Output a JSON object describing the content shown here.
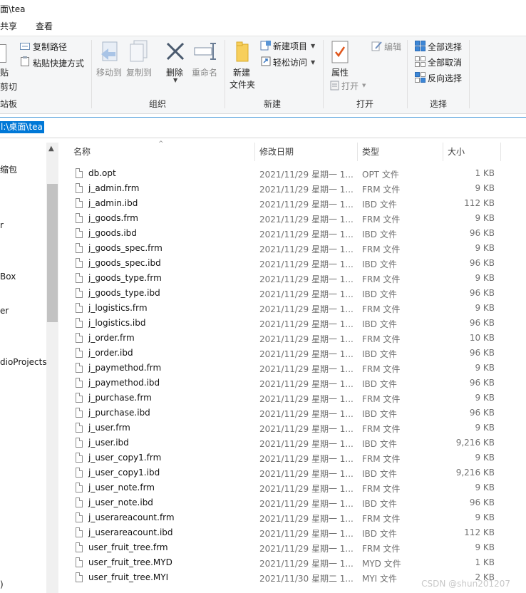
{
  "window": {
    "title": "面\\tea"
  },
  "menu": {
    "share": "共享",
    "view": "查看"
  },
  "ribbon": {
    "clipboard": {
      "paste_partial": "贴",
      "cut_partial": "剪切",
      "group_partial": "站板",
      "copy_path": "复制路径",
      "paste_shortcut": "粘贴快捷方式"
    },
    "organize": {
      "move_to": "移动到",
      "copy_to": "复制到",
      "delete": "删除",
      "rename": "重命名",
      "group": "组织"
    },
    "new": {
      "new_folder_line1": "新建",
      "new_folder_line2": "文件夹",
      "new_item": "新建项目",
      "easy_access": "轻松访问",
      "group": "新建"
    },
    "open": {
      "properties": "属性",
      "open": "打开",
      "edit": "编辑",
      "group": "打开"
    },
    "select": {
      "select_all": "全部选择",
      "select_none": "全部取消",
      "invert": "反向选择",
      "group": "选择"
    }
  },
  "address": {
    "path": "l:\\桌面\\tea"
  },
  "nav_pane": {
    "items": [
      "缩包",
      "r",
      "Box",
      "er",
      "dioProjects",
      ")"
    ]
  },
  "columns": {
    "name": "名称",
    "date": "修改日期",
    "type": "类型",
    "size": "大小"
  },
  "files": [
    {
      "name": "db.opt",
      "date": "2021/11/29 星期一 1...",
      "type": "OPT 文件",
      "size": "1 KB"
    },
    {
      "name": "j_admin.frm",
      "date": "2021/11/29 星期一 1...",
      "type": "FRM 文件",
      "size": "9 KB"
    },
    {
      "name": "j_admin.ibd",
      "date": "2021/11/29 星期一 1...",
      "type": "IBD 文件",
      "size": "112 KB"
    },
    {
      "name": "j_goods.frm",
      "date": "2021/11/29 星期一 1...",
      "type": "FRM 文件",
      "size": "9 KB"
    },
    {
      "name": "j_goods.ibd",
      "date": "2021/11/29 星期一 1...",
      "type": "IBD 文件",
      "size": "96 KB"
    },
    {
      "name": "j_goods_spec.frm",
      "date": "2021/11/29 星期一 1...",
      "type": "FRM 文件",
      "size": "9 KB"
    },
    {
      "name": "j_goods_spec.ibd",
      "date": "2021/11/29 星期一 1...",
      "type": "IBD 文件",
      "size": "96 KB"
    },
    {
      "name": "j_goods_type.frm",
      "date": "2021/11/29 星期一 1...",
      "type": "FRM 文件",
      "size": "9 KB"
    },
    {
      "name": "j_goods_type.ibd",
      "date": "2021/11/29 星期一 1...",
      "type": "IBD 文件",
      "size": "96 KB"
    },
    {
      "name": "j_logistics.frm",
      "date": "2021/11/29 星期一 1...",
      "type": "FRM 文件",
      "size": "9 KB"
    },
    {
      "name": "j_logistics.ibd",
      "date": "2021/11/29 星期一 1...",
      "type": "IBD 文件",
      "size": "96 KB"
    },
    {
      "name": "j_order.frm",
      "date": "2021/11/29 星期一 1...",
      "type": "FRM 文件",
      "size": "10 KB"
    },
    {
      "name": "j_order.ibd",
      "date": "2021/11/29 星期一 1...",
      "type": "IBD 文件",
      "size": "96 KB"
    },
    {
      "name": "j_paymethod.frm",
      "date": "2021/11/29 星期一 1...",
      "type": "FRM 文件",
      "size": "9 KB"
    },
    {
      "name": "j_paymethod.ibd",
      "date": "2021/11/29 星期一 1...",
      "type": "IBD 文件",
      "size": "96 KB"
    },
    {
      "name": "j_purchase.frm",
      "date": "2021/11/29 星期一 1...",
      "type": "FRM 文件",
      "size": "9 KB"
    },
    {
      "name": "j_purchase.ibd",
      "date": "2021/11/29 星期一 1...",
      "type": "IBD 文件",
      "size": "96 KB"
    },
    {
      "name": "j_user.frm",
      "date": "2021/11/29 星期一 1...",
      "type": "FRM 文件",
      "size": "9 KB"
    },
    {
      "name": "j_user.ibd",
      "date": "2021/11/29 星期一 1...",
      "type": "IBD 文件",
      "size": "9,216 KB"
    },
    {
      "name": "j_user_copy1.frm",
      "date": "2021/11/29 星期一 1...",
      "type": "FRM 文件",
      "size": "9 KB"
    },
    {
      "name": "j_user_copy1.ibd",
      "date": "2021/11/29 星期一 1...",
      "type": "IBD 文件",
      "size": "9,216 KB"
    },
    {
      "name": "j_user_note.frm",
      "date": "2021/11/29 星期一 1...",
      "type": "FRM 文件",
      "size": "9 KB"
    },
    {
      "name": "j_user_note.ibd",
      "date": "2021/11/29 星期一 1...",
      "type": "IBD 文件",
      "size": "96 KB"
    },
    {
      "name": "j_userareacount.frm",
      "date": "2021/11/29 星期一 1...",
      "type": "FRM 文件",
      "size": "9 KB"
    },
    {
      "name": "j_userareacount.ibd",
      "date": "2021/11/29 星期一 1...",
      "type": "IBD 文件",
      "size": "112 KB"
    },
    {
      "name": "user_fruit_tree.frm",
      "date": "2021/11/29 星期一 1...",
      "type": "FRM 文件",
      "size": "9 KB"
    },
    {
      "name": "user_fruit_tree.MYD",
      "date": "2021/11/29 星期一 1...",
      "type": "MYD 文件",
      "size": "1 KB"
    },
    {
      "name": "user_fruit_tree.MYI",
      "date": "2021/11/30 星期二 1...",
      "type": "MYI 文件",
      "size": "2 KB"
    }
  ],
  "watermark": "CSDN @shun201207",
  "colors": {
    "accent": "#0078d7",
    "ribbon_bg": "#f5f6f7",
    "muted_text": "#707070"
  }
}
